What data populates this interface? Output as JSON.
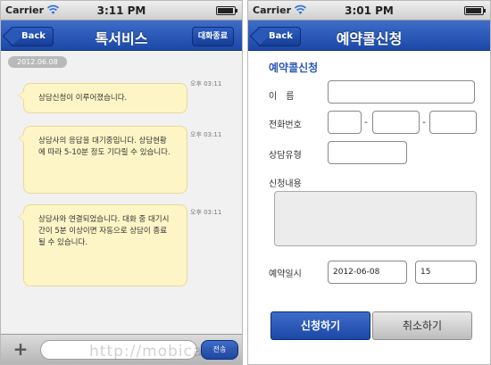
{
  "left_screen": {
    "status_bar": {
      "carrier": "Carrier",
      "time": "3:11 PM"
    },
    "nav": {
      "back_label": "Back",
      "title": "톡서비스",
      "end_label": "대화종료"
    },
    "date_badge": "2012.06.08",
    "messages": [
      {
        "text": "상담신청이 이루어졌습니다.",
        "time": "오후 03:11"
      },
      {
        "text": "상담사의 응답을 대기중입니다. 상담현황에 따라 5-10분 정도 기다릴 수 있습니다.",
        "time": "오후 03:11"
      },
      {
        "text": "상담사와 연결되었습니다. 대화 중 대기시간이 5분 이상이면 자동으로 상담이 종료될 수 있습니다.",
        "time": "오후 03:11"
      }
    ],
    "input_bar": {
      "plus_label": "+",
      "send_label": "전송"
    }
  },
  "right_screen": {
    "status_bar": {
      "carrier": "Carrier",
      "time": "3:01 PM"
    },
    "nav": {
      "back_label": "Back",
      "title": "예약콜신청"
    },
    "form": {
      "heading": "예약콜신청",
      "name_label": "이　름",
      "phone_label": "전화번호",
      "phone_dash": "-",
      "type_label": "상담유형",
      "content_label": "신청내용",
      "datetime_label": "예약일시",
      "date_value": "2012-06-08",
      "hour_value": "15"
    },
    "buttons": {
      "apply": "신청하기",
      "cancel": "취소하기"
    }
  },
  "watermark": "http://mobican.bn",
  "colors": {
    "nav_blue": "#2c58b8",
    "bubble": "#fdf5c6",
    "status_bar": "#dedede"
  }
}
